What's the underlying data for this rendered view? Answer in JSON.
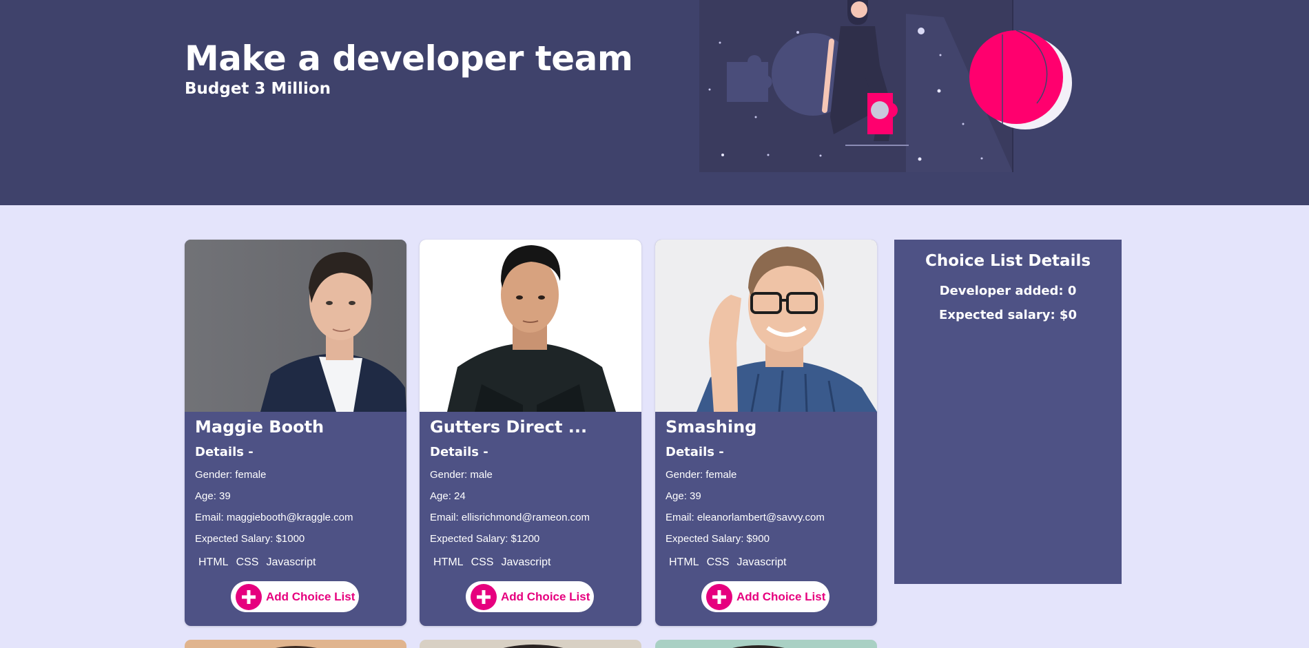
{
  "hero": {
    "title": "Make a developer team",
    "subtitle": "Budget 3 Million",
    "accent_color": "#ff006e",
    "background_color": "#3f426b"
  },
  "developers": [
    {
      "name": "Maggie Booth",
      "details_heading": "Details -",
      "gender": "Gender: female",
      "age": "Age: 39",
      "email": "Email: maggiebooth@kraggle.com",
      "salary": "Expected Salary: $1000",
      "skills": [
        "HTML",
        "CSS",
        "Javascript"
      ],
      "button_label": "Add Choice List"
    },
    {
      "name": "Gutters Direct ...",
      "details_heading": "Details -",
      "gender": "Gender: male",
      "age": "Age: 24",
      "email": "Email: ellisrichmond@rameon.com",
      "salary": "Expected Salary: $1200",
      "skills": [
        "HTML",
        "CSS",
        "Javascript"
      ],
      "button_label": "Add Choice List"
    },
    {
      "name": "Smashing",
      "details_heading": "Details -",
      "gender": "Gender: female",
      "age": "Age: 39",
      "email": "Email: eleanorlambert@savvy.com",
      "salary": "Expected Salary: $900",
      "skills": [
        "HTML",
        "CSS",
        "Javascript"
      ],
      "button_label": "Add Choice List"
    }
  ],
  "choice_list": {
    "title": "Choice List Details",
    "developer_added": "Developer added: 0",
    "expected_salary": "Expected salary: $0"
  },
  "colors": {
    "page_background": "#e4e4fb",
    "card_background": "#4e5285",
    "button_text": "#e6007e"
  }
}
